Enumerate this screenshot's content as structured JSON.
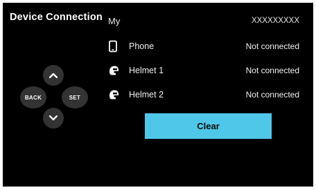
{
  "header": {
    "title": "Device Connection",
    "my_label": "My",
    "my_value": "XXXXXXXXX"
  },
  "devices": [
    {
      "name": "Phone",
      "status": "Not connected",
      "icon": "phone-icon"
    },
    {
      "name": "Helmet 1",
      "status": "Not connected",
      "icon": "helmet-icon"
    },
    {
      "name": "Helmet 2",
      "status": "Not connected",
      "icon": "helmet-icon"
    }
  ],
  "actions": {
    "clear_label": "Clear"
  },
  "dpad": {
    "back_label": "BACK",
    "set_label": "SET",
    "up_icon": "chevron-up-icon",
    "down_icon": "chevron-down-icon"
  },
  "colors": {
    "background": "#000000",
    "accent": "#4fc7e8",
    "dpad_button": "#333333"
  }
}
